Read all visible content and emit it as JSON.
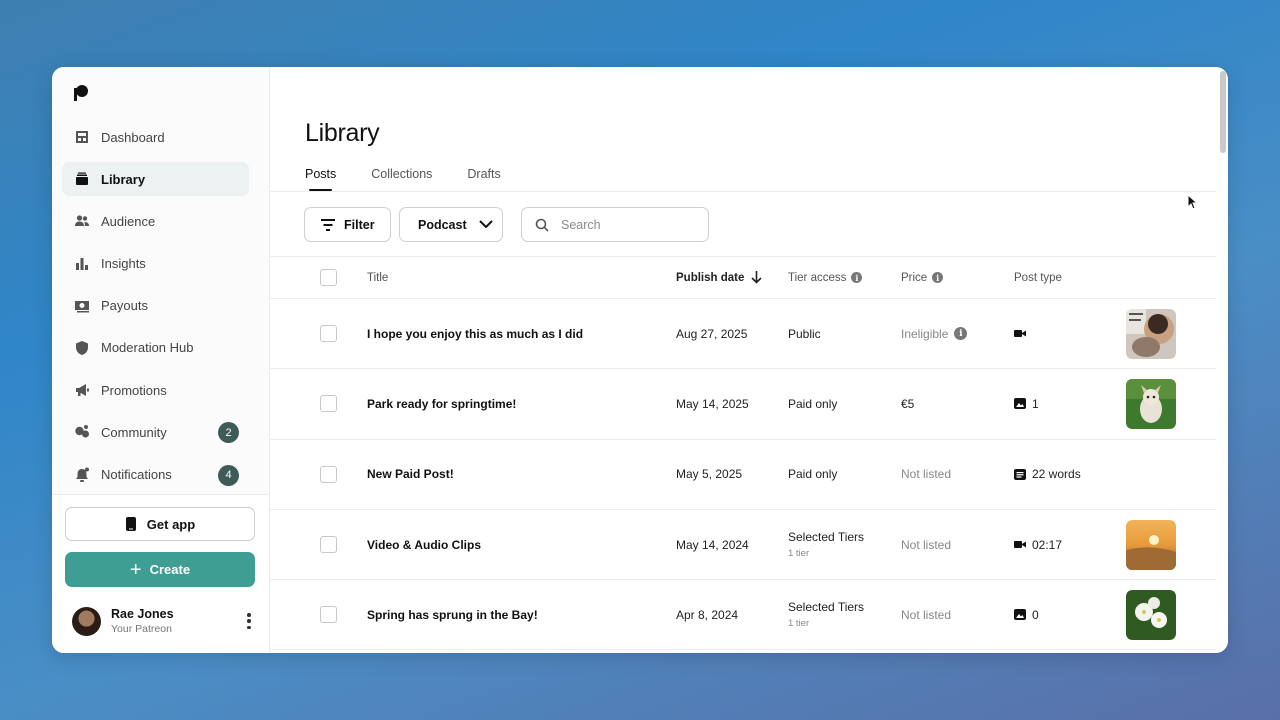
{
  "sidebar": {
    "items": [
      {
        "label": "Dashboard",
        "icon": "dashboard-icon"
      },
      {
        "label": "Library",
        "icon": "library-icon",
        "active": true
      },
      {
        "label": "Audience",
        "icon": "audience-icon"
      },
      {
        "label": "Insights",
        "icon": "insights-icon"
      },
      {
        "label": "Payouts",
        "icon": "payouts-icon"
      },
      {
        "label": "Moderation Hub",
        "icon": "shield-icon"
      },
      {
        "label": "Promotions",
        "icon": "megaphone-icon"
      },
      {
        "label": "Community",
        "icon": "community-icon",
        "badge": "2"
      },
      {
        "label": "Notifications",
        "icon": "bell-icon",
        "badge": "4"
      }
    ],
    "get_app_label": "Get app",
    "create_label": "Create",
    "user": {
      "name": "Rae Jones",
      "subtitle": "Your Patreon"
    }
  },
  "main": {
    "title": "Library",
    "tabs": [
      "Posts",
      "Collections",
      "Drafts"
    ],
    "toolbar": {
      "filter_label": "Filter",
      "podcast_label": "Podcast",
      "search_placeholder": "Search"
    },
    "table": {
      "headers": {
        "title": "Title",
        "publish_date": "Publish date",
        "tier_access": "Tier access",
        "price": "Price",
        "post_type": "Post type"
      },
      "rows": [
        {
          "title": "I hope you enjoy this as much as I did",
          "date": "Aug 27, 2025",
          "tier": "Public",
          "tier_sub": "",
          "price": "Ineligible",
          "type_icon": "video-icon",
          "type_text": "",
          "thumb": "selfie"
        },
        {
          "title": "Park ready for springtime!",
          "date": "May 14, 2025",
          "tier": "Paid only",
          "tier_sub": "",
          "price": "€5",
          "type_icon": "image-icon",
          "type_text": "1",
          "thumb": "dog"
        },
        {
          "title": "New Paid Post!",
          "date": "May 5, 2025",
          "tier": "Paid only",
          "tier_sub": "",
          "price": "Not listed",
          "type_icon": "text-icon",
          "type_text": "22 words",
          "thumb": ""
        },
        {
          "title": "Video & Audio Clips",
          "date": "May 14, 2024",
          "tier": "Selected Tiers",
          "tier_sub": "1 tier",
          "price": "Not listed",
          "type_icon": "video-icon",
          "type_text": "02:17",
          "thumb": "sunset"
        },
        {
          "title": "Spring has sprung in the Bay!",
          "date": "Apr 8, 2024",
          "tier": "Selected Tiers",
          "tier_sub": "1 tier",
          "price": "Not listed",
          "type_icon": "image-icon",
          "type_text": "0",
          "thumb": "flowers"
        }
      ]
    }
  },
  "colors": {
    "accent": "#3e9e93",
    "badge": "#3e5b57"
  }
}
